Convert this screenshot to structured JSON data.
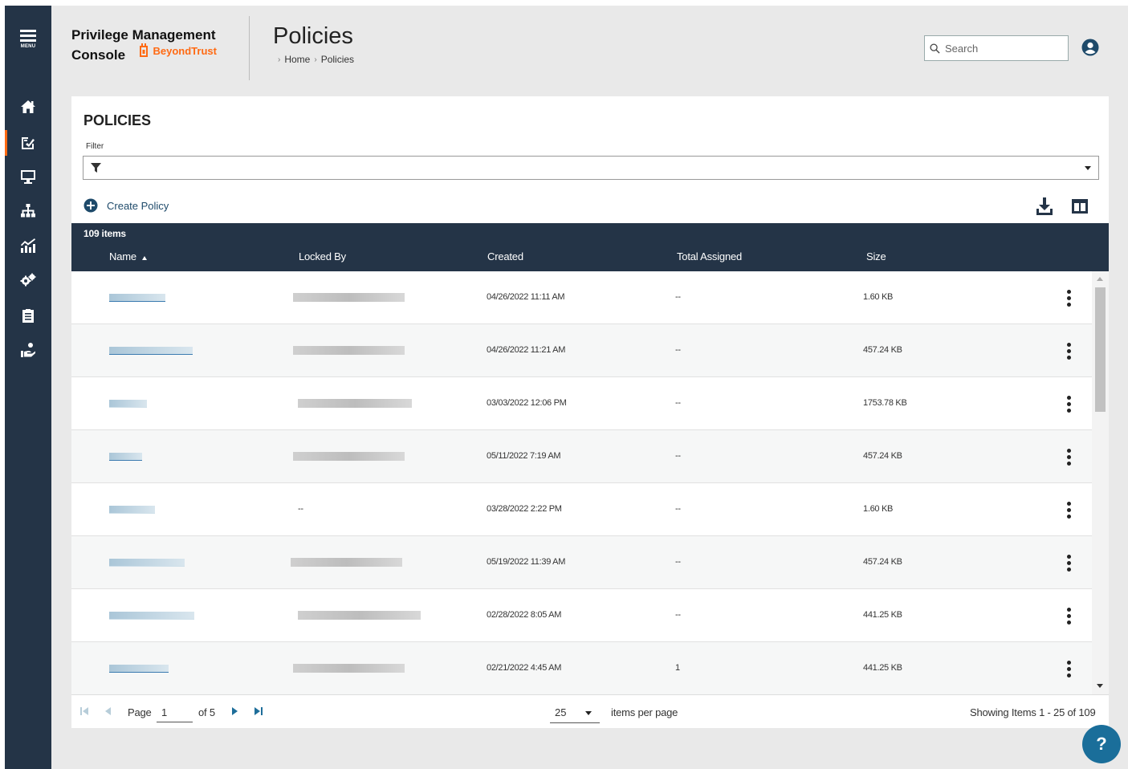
{
  "menu_label": "MENU",
  "brand": {
    "line1": "Privilege Management",
    "line2": "Console",
    "vendor": "BeyondTrust"
  },
  "header": {
    "title": "Policies",
    "breadcrumb": [
      "Home",
      "Policies"
    ],
    "search_placeholder": "Search"
  },
  "sidebar": {
    "items": [
      {
        "icon": "home-icon",
        "active": false
      },
      {
        "icon": "policy-editor-icon",
        "active": true
      },
      {
        "icon": "computer-icon",
        "active": false
      },
      {
        "icon": "groups-icon",
        "active": false
      },
      {
        "icon": "analytics-icon",
        "active": false
      },
      {
        "icon": "configuration-icon",
        "active": false
      },
      {
        "icon": "clipboard-icon",
        "active": false
      },
      {
        "icon": "deploy-icon",
        "active": false
      }
    ]
  },
  "panel": {
    "title": "POLICIES",
    "filter_label": "Filter",
    "create_label": "Create Policy"
  },
  "grid": {
    "count_label": "109 items",
    "columns": [
      "Name",
      "Locked By",
      "Created",
      "Total Assigned",
      "Size"
    ],
    "rows": [
      {
        "locked": "",
        "created": "04/26/2022 11:11 AM",
        "assigned": "--",
        "size": "1.60 KB"
      },
      {
        "locked": "",
        "created": "04/26/2022 11:21 AM",
        "assigned": "--",
        "size": "457.24 KB"
      },
      {
        "locked": "",
        "created": "03/03/2022 12:06 PM",
        "assigned": "--",
        "size": "1753.78 KB"
      },
      {
        "locked": "",
        "created": "05/11/2022 7:19 AM",
        "assigned": "--",
        "size": "457.24 KB"
      },
      {
        "locked": "--",
        "created": "03/28/2022 2:22 PM",
        "assigned": "--",
        "size": "1.60 KB"
      },
      {
        "locked": "",
        "created": "05/19/2022 11:39 AM",
        "assigned": "--",
        "size": "457.24 KB"
      },
      {
        "locked": "",
        "created": "02/28/2022 8:05 AM",
        "assigned": "--",
        "size": "441.25 KB"
      },
      {
        "locked": "",
        "created": "02/21/2022 4:45 AM",
        "assigned": "1",
        "size": "441.25 KB"
      }
    ]
  },
  "pager": {
    "page_label": "Page",
    "page_value": "1",
    "of_label": "of 5",
    "per_page_value": "25",
    "per_page_label": "items per page",
    "showing": "Showing Items 1 - 25 of 109"
  },
  "help_label": "?",
  "colors": {
    "sidebar": "#243447",
    "accent": "#ff6a13",
    "link": "#1e4a6a",
    "help": "#1a6e9a"
  }
}
